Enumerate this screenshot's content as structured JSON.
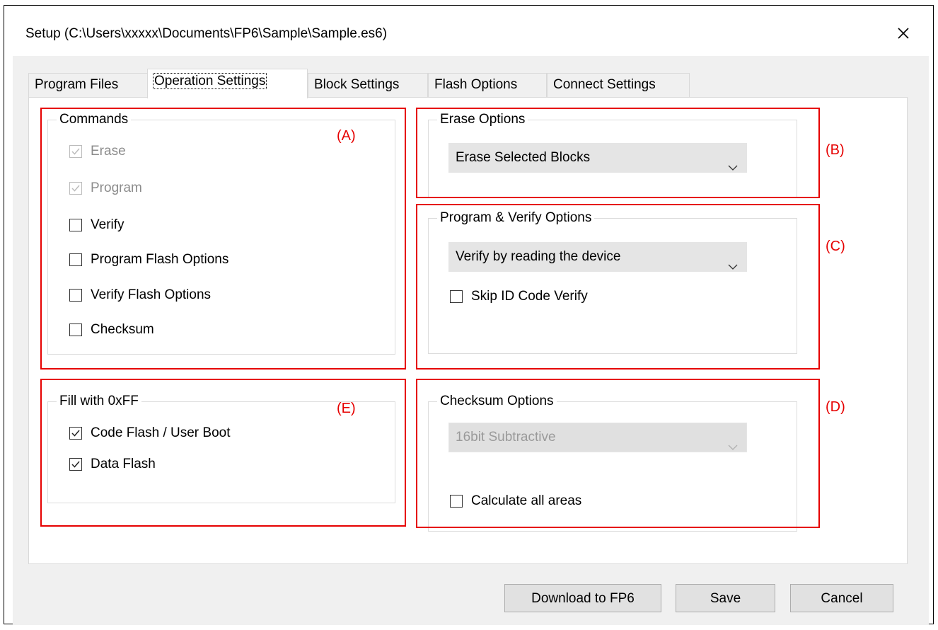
{
  "window": {
    "title": "Setup (C:\\Users\\xxxxx\\Documents\\FP6\\Sample\\Sample.es6)"
  },
  "tabs": [
    {
      "label": "Program Files",
      "active": false
    },
    {
      "label": "Operation Settings",
      "active": true
    },
    {
      "label": "Block Settings",
      "active": false
    },
    {
      "label": "Flash Options",
      "active": false
    },
    {
      "label": "Connect Settings",
      "active": false
    }
  ],
  "commands": {
    "legend": "Commands",
    "items": [
      {
        "label": "Erase",
        "checked": true,
        "disabled": true
      },
      {
        "label": "Program",
        "checked": true,
        "disabled": true
      },
      {
        "label": "Verify",
        "checked": false,
        "disabled": false
      },
      {
        "label": "Program Flash Options",
        "checked": false,
        "disabled": false
      },
      {
        "label": "Verify Flash Options",
        "checked": false,
        "disabled": false
      },
      {
        "label": "Checksum",
        "checked": false,
        "disabled": false
      }
    ]
  },
  "erase_options": {
    "legend": "Erase Options",
    "selected": "Erase Selected Blocks"
  },
  "program_verify_options": {
    "legend": "Program & Verify Options",
    "selected": "Verify by reading the device",
    "skip_id_label": "Skip ID Code Verify",
    "skip_id_checked": false
  },
  "fill": {
    "legend": "Fill with 0xFF",
    "items": [
      {
        "label": "Code Flash / User Boot",
        "checked": true
      },
      {
        "label": "Data Flash",
        "checked": true
      }
    ]
  },
  "checksum_options": {
    "legend": "Checksum Options",
    "selected": "16bit Subtractive",
    "disabled": true,
    "calc_all_label": "Calculate all areas",
    "calc_all_checked": false
  },
  "annotations": {
    "a": "(A)",
    "b": "(B)",
    "c": "(C)",
    "d": "(D)",
    "e": "(E)"
  },
  "buttons": {
    "download": "Download to FP6",
    "save": "Save",
    "cancel": "Cancel"
  },
  "colors": {
    "annotation": "#e60000",
    "window_bg": "#f0f0f0",
    "combo_bg": "#e5e5e5"
  }
}
